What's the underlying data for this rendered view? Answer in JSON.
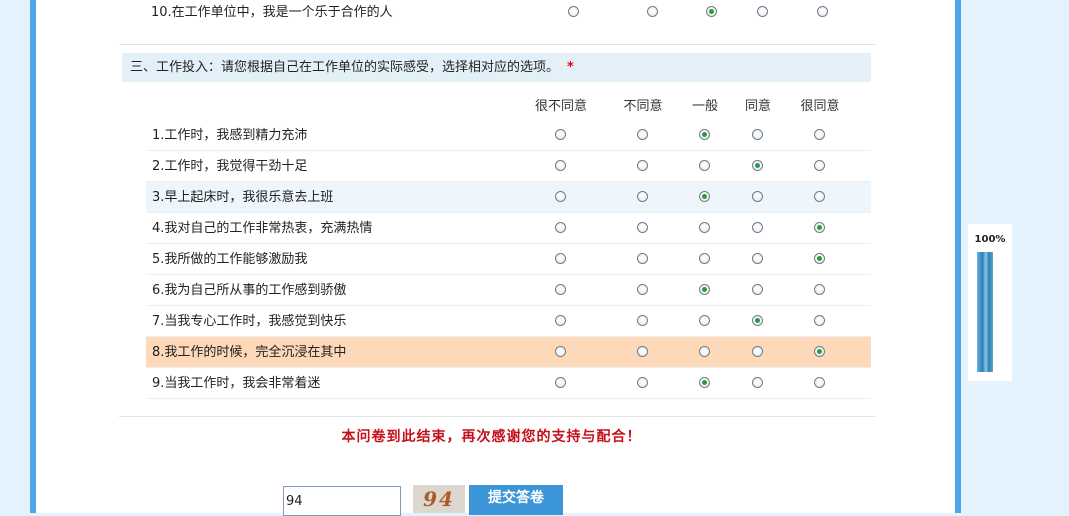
{
  "survey": {
    "previous_question": {
      "text": "10.在工作单位中，我是一个乐于合作的人",
      "selected": 2
    },
    "section": {
      "title": "三、工作投入：请您根据自己在工作单位的实际感受，选择相对应的选项。",
      "required_mark": "*",
      "columns": [
        "很不同意",
        "不同意",
        "一般",
        "同意",
        "很同意"
      ],
      "questions": [
        {
          "text": "1.工作时，我感到精力充沛",
          "selected": 2
        },
        {
          "text": "2.工作时，我觉得干劲十足",
          "selected": 3
        },
        {
          "text": "3.早上起床时，我很乐意去上班",
          "selected": 2
        },
        {
          "text": "4.我对自己的工作非常热衷，充满热情",
          "selected": 4
        },
        {
          "text": "5.我所做的工作能够激励我",
          "selected": 4
        },
        {
          "text": "6.我为自己所从事的工作感到骄傲",
          "selected": 2
        },
        {
          "text": "7.当我专心工作时，我感觉到快乐",
          "selected": 3
        },
        {
          "text": "8.我工作的时候，完全沉浸在其中",
          "selected": 4
        },
        {
          "text": "9.当我工作时，我会非常着迷",
          "selected": 2
        }
      ]
    },
    "end_message": "本问卷到此结束，再次感谢您的支持与配合！",
    "captcha": {
      "value": "94",
      "image_text": "94"
    },
    "submit_label": "提交答卷"
  },
  "progress": {
    "label": "100%",
    "percent": 100
  },
  "colors": {
    "accent": "#4da6e8",
    "selected_dot": "#2e9a38",
    "highlight_row": "#fdd8b9",
    "end_message": "#c6101b"
  }
}
